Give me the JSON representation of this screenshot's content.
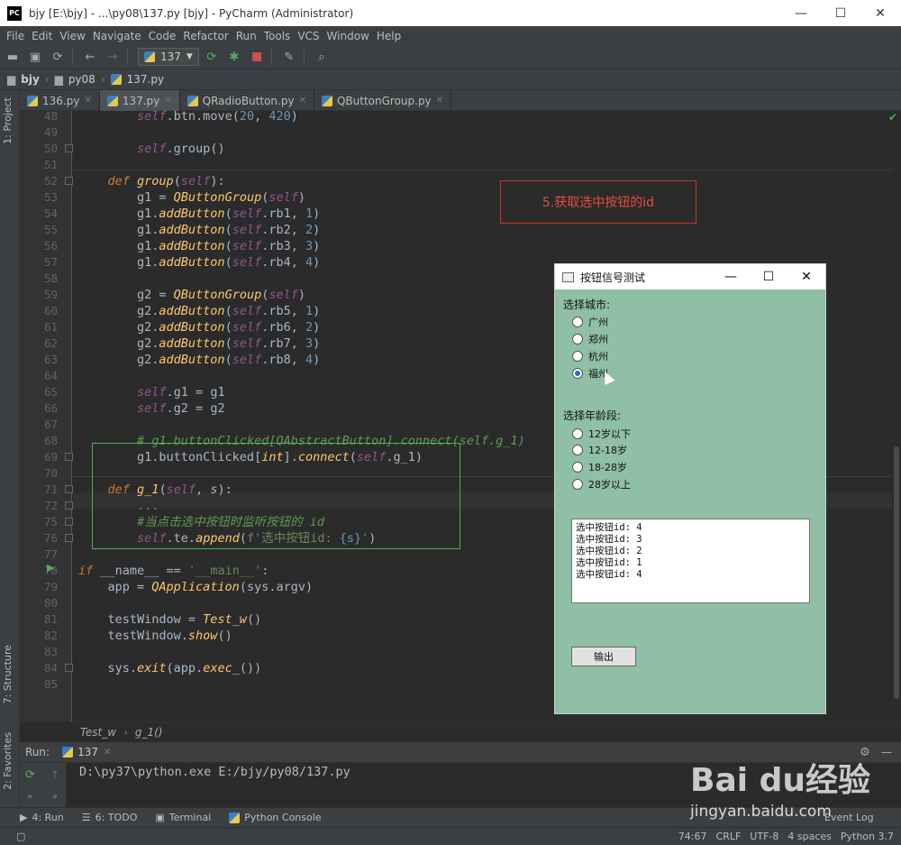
{
  "window": {
    "title": "bjy [E:\\bjy] - ...\\py08\\137.py [bjy] - PyCharm (Administrator)",
    "app_badge": "PC",
    "minimize": "—",
    "maximize": "☐",
    "close": "✕"
  },
  "menu": [
    "File",
    "Edit",
    "View",
    "Navigate",
    "Code",
    "Refactor",
    "Run",
    "Tools",
    "VCS",
    "Window",
    "Help"
  ],
  "toolbar": {
    "run_config": "137"
  },
  "breadcrumb": {
    "project": "bjy",
    "folder": "py08",
    "file": "137.py"
  },
  "side_tabs": {
    "project": "1: Project",
    "structure": "7: Structure",
    "favorites": "2: Favorites"
  },
  "tabs": [
    {
      "label": "136.py"
    },
    {
      "label": "137.py"
    },
    {
      "label": "QRadioButton.py"
    },
    {
      "label": "QButtonGroup.py"
    }
  ],
  "line_numbers": [
    "48",
    "49",
    "50",
    "51",
    "52",
    "53",
    "54",
    "55",
    "56",
    "57",
    "58",
    "59",
    "60",
    "61",
    "62",
    "63",
    "64",
    "65",
    "66",
    "67",
    "68",
    "69",
    "70",
    "71",
    "72",
    "75",
    "76",
    "77",
    "78",
    "79",
    "80",
    "81",
    "82",
    "83",
    "84",
    "85"
  ],
  "annotation": "5.获取选中按钮的id",
  "code_breadcrumb": {
    "class": "Test_w",
    "method": "g_1()"
  },
  "run_panel": {
    "label": "Run:",
    "tab": "137",
    "output": "D:\\py37\\python.exe E:/bjy/py08/137.py"
  },
  "bottom_tabs": [
    {
      "label": "4: Run"
    },
    {
      "label": "6: TODO"
    },
    {
      "label": "Terminal"
    },
    {
      "label": "Python Console"
    },
    {
      "label": "Event Log"
    }
  ],
  "status": {
    "position": "74:67",
    "line_sep": "CRLF",
    "encoding": "UTF-8",
    "indent": "4 spaces",
    "interpreter": "Python 3.7"
  },
  "qt_window": {
    "title": "按钮信号测试",
    "city_label": "选择城市:",
    "cities": [
      {
        "label": "广州",
        "checked": false
      },
      {
        "label": "郑州",
        "checked": false
      },
      {
        "label": "杭州",
        "checked": false
      },
      {
        "label": "福州",
        "checked": true
      }
    ],
    "age_label": "选择年龄段:",
    "ages": [
      {
        "label": "12岁以下",
        "checked": false
      },
      {
        "label": "12-18岁",
        "checked": false
      },
      {
        "label": "18-28岁",
        "checked": false
      },
      {
        "label": "28岁以上",
        "checked": false
      }
    ],
    "log_lines": [
      "选中按钮id: 4",
      "选中按钮id: 3",
      "选中按钮id: 2",
      "选中按钮id: 1",
      "选中按钮id: 4"
    ],
    "output_button": "输出"
  },
  "watermark": {
    "brand": "Bai du经验",
    "url": "jingyan.baidu.com"
  }
}
